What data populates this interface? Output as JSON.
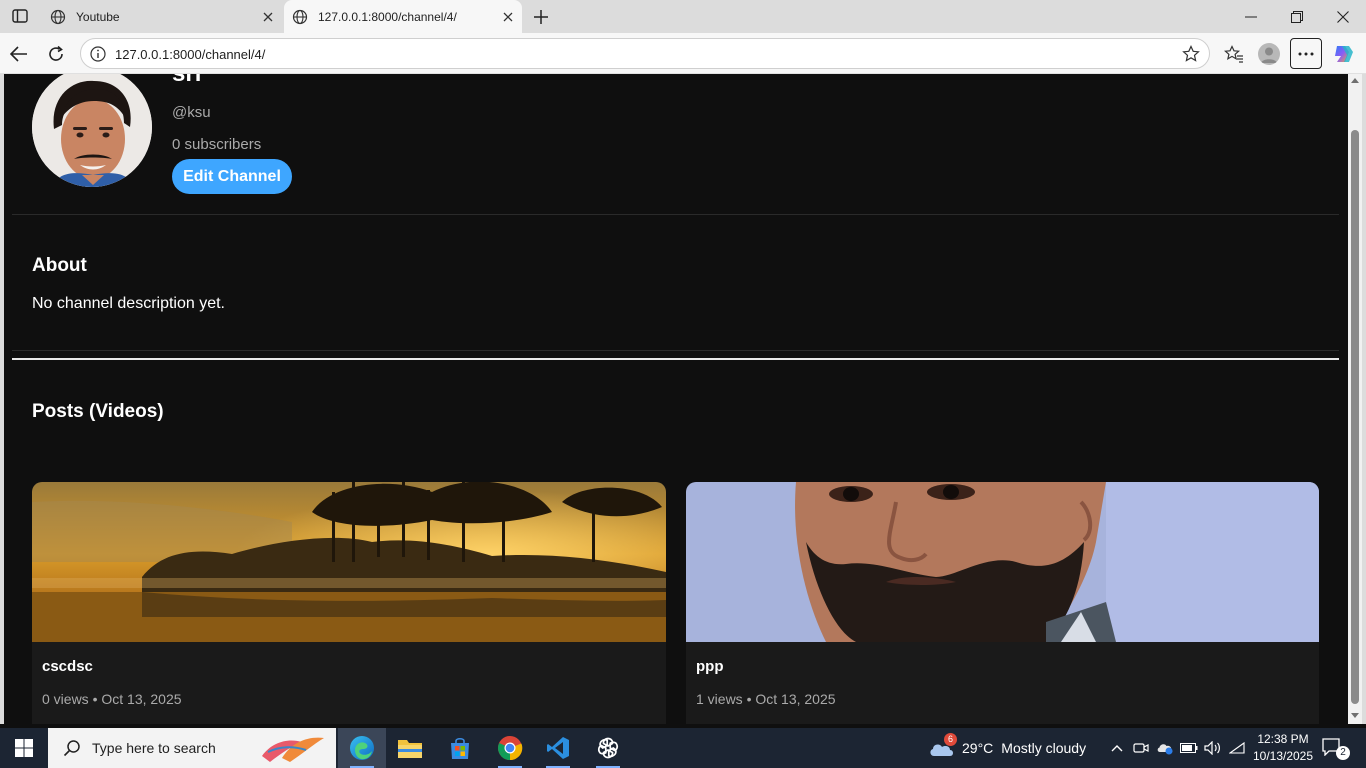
{
  "browser": {
    "tabs": [
      {
        "title": "Youtube",
        "active": false
      },
      {
        "title": "127.0.0.1:8000/channel/4/",
        "active": true
      }
    ],
    "address_url": "127.0.0.1:8000/channel/4/"
  },
  "channel": {
    "name": "sri",
    "handle": "@ksu",
    "subscribers": "0 subscribers",
    "edit_label": "Edit Channel"
  },
  "about": {
    "heading": "About",
    "text": "No channel description yet."
  },
  "posts": {
    "heading": "Posts (Videos)",
    "videos": [
      {
        "title": "cscdsc",
        "meta": "0 views • Oct 13, 2025",
        "thumbnail": "misty-lake-sunrise"
      },
      {
        "title": "ppp",
        "meta": "1 views • Oct 13, 2025",
        "thumbnail": "bearded-man-portrait"
      }
    ]
  },
  "taskbar": {
    "search_placeholder": "Type here to search",
    "weather_badge": "6",
    "temperature": "29°C",
    "weather_desc": "Mostly cloudy",
    "time": "12:38 PM",
    "date": "10/13/2025",
    "notification_count": "2"
  },
  "colors": {
    "page_bg": "#0f0f0f",
    "accent": "#3ea6ff",
    "card_bg": "#1a1a1a",
    "muted_text": "#aaaaaa"
  }
}
